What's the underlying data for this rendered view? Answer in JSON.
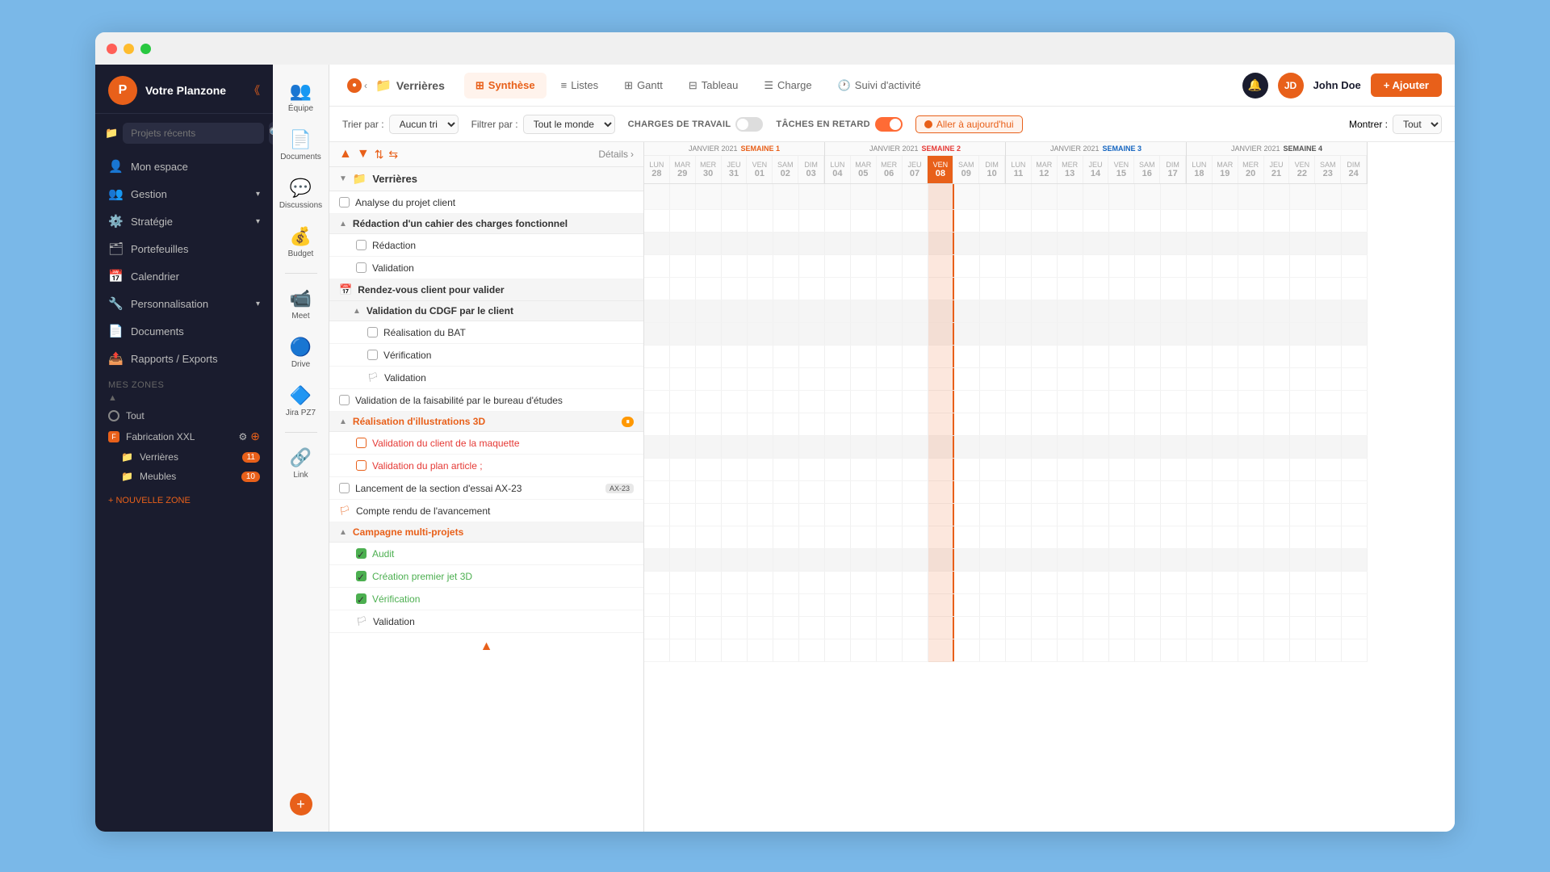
{
  "window": {
    "title": "Planzone"
  },
  "titlebar": {
    "dots": [
      "red",
      "yellow",
      "green"
    ]
  },
  "sidebar": {
    "logo_text": "P",
    "workspace": "Votre Planzone",
    "search_placeholder": "Projets récents",
    "nav_items": [
      {
        "id": "mon-espace",
        "label": "Mon espace",
        "icon": "👤"
      },
      {
        "id": "gestion",
        "label": "Gestion",
        "icon": "👥"
      },
      {
        "id": "strategie",
        "label": "Stratégie",
        "icon": "⚙️"
      },
      {
        "id": "portefeuilles",
        "label": "Portefeuilles",
        "icon": "🗂"
      },
      {
        "id": "calendrier",
        "label": "Calendrier",
        "icon": "📅"
      },
      {
        "id": "personnalisation",
        "label": "Personnalisation",
        "icon": "🔧"
      },
      {
        "id": "documents",
        "label": "Documents",
        "icon": "📄"
      },
      {
        "id": "rapports",
        "label": "Rapports / Exports",
        "icon": "📤"
      }
    ],
    "mes_zones": "Mes Zones",
    "zones": [
      {
        "id": "tout",
        "label": "Tout",
        "icon": "circle"
      },
      {
        "id": "fabrication-xxl",
        "label": "Fabrication XXL",
        "icon": "F",
        "color": "#e8601a",
        "has_settings": true
      },
      {
        "id": "verrieres",
        "label": "Verrières",
        "icon": "folder",
        "badge": "11"
      },
      {
        "id": "meubles",
        "label": "Meubles",
        "icon": "folder",
        "badge": "10"
      }
    ],
    "new_zone_label": "+ NOUVELLE ZONE"
  },
  "tools": [
    {
      "id": "equipe",
      "label": "Équipe",
      "icon": "👥"
    },
    {
      "id": "documents",
      "label": "Documents",
      "icon": "📄"
    },
    {
      "id": "discussions",
      "label": "Discussions",
      "icon": "💬"
    },
    {
      "id": "budget",
      "label": "Budget",
      "icon": "💰"
    },
    {
      "id": "meet",
      "label": "Meet",
      "icon": "📹"
    },
    {
      "id": "drive",
      "label": "Drive",
      "icon": "🔵"
    },
    {
      "id": "jira",
      "label": "Jira PZ7",
      "icon": "🔷"
    },
    {
      "id": "link",
      "label": "Link",
      "icon": "🔗"
    }
  ],
  "topnav": {
    "folder_name": "Verrières",
    "tabs": [
      {
        "id": "listes",
        "label": "Listes",
        "icon": "≡"
      },
      {
        "id": "gantt",
        "label": "Gantt",
        "icon": "⊞"
      },
      {
        "id": "tableau",
        "label": "Tableau",
        "icon": "⊟"
      },
      {
        "id": "charge",
        "label": "Charge",
        "icon": "☰"
      },
      {
        "id": "suivi",
        "label": "Suivi d'activité",
        "icon": "🕐"
      }
    ],
    "active_tab": "Synthèse",
    "active_tab_icon": "⊞",
    "notification_icon": "🔔",
    "user": {
      "name": "John Doe",
      "initials": "JD"
    },
    "add_button": "+ Ajouter"
  },
  "filters": {
    "trier_par_label": "Trier par :",
    "trier_value": "Aucun tri",
    "filtrer_par_label": "Filtrer par :",
    "filtrer_value": "Tout le monde",
    "charges_label": "CHARGES DE TRAVAIL",
    "taches_label": "TÂCHES EN RETARD",
    "today_btn": "Aller à aujourd'hui",
    "montrer_label": "Montrer :",
    "montrer_value": "Tout"
  },
  "gantt_header": {
    "weeks": [
      {
        "month": "JANVIER 2021",
        "week_num": "SEMAINE 1",
        "week_class": "s1",
        "days": [
          {
            "name": "LUN",
            "num": "28"
          },
          {
            "name": "MAR",
            "num": "29"
          },
          {
            "name": "MER",
            "num": "30"
          },
          {
            "name": "JEU",
            "num": "31"
          },
          {
            "name": "VEN",
            "num": "01"
          },
          {
            "name": "SAM",
            "num": "02"
          },
          {
            "name": "DIM",
            "num": "03"
          }
        ]
      },
      {
        "month": "JANVIER 2021",
        "week_num": "SEMAINE 2",
        "week_class": "s2",
        "days": [
          {
            "name": "LUN",
            "num": "04"
          },
          {
            "name": "MAR",
            "num": "05"
          },
          {
            "name": "MER",
            "num": "06"
          },
          {
            "name": "JEU",
            "num": "07"
          },
          {
            "name": "VEN",
            "num": "08",
            "today": true
          },
          {
            "name": "SAM",
            "num": "09"
          },
          {
            "name": "DIM",
            "num": "10"
          }
        ]
      },
      {
        "month": "JANVIER 2021",
        "week_num": "SEMAINE 3",
        "week_class": "s3",
        "days": [
          {
            "name": "LUN",
            "num": "11"
          },
          {
            "name": "MAR",
            "num": "12"
          },
          {
            "name": "MER",
            "num": "13"
          },
          {
            "name": "JEU",
            "num": "14"
          },
          {
            "name": "VEN",
            "num": "15"
          },
          {
            "name": "SAM",
            "num": "16"
          },
          {
            "name": "DIM",
            "num": "17"
          }
        ]
      },
      {
        "month": "JANVIER 2021",
        "week_num": "SEMAINE 4",
        "week_class": "s4",
        "days": [
          {
            "name": "LUN",
            "num": "18"
          },
          {
            "name": "MAR",
            "num": "19"
          },
          {
            "name": "MER",
            "num": "20"
          },
          {
            "name": "JEU",
            "num": "21"
          },
          {
            "name": "VEN",
            "num": "22"
          },
          {
            "name": "SAM",
            "num": "23"
          },
          {
            "name": "DIM",
            "num": "24"
          }
        ]
      }
    ]
  },
  "tasks": [
    {
      "type": "folder",
      "name": "Verrières",
      "indent": 0
    },
    {
      "type": "task",
      "name": "Analyse du projet client",
      "indent": 0,
      "checked": false
    },
    {
      "type": "group",
      "name": "Rédaction d'un cahier des charges fonctionnel",
      "indent": 0,
      "expanded": true
    },
    {
      "type": "task",
      "name": "Rédaction",
      "indent": 1,
      "checked": false
    },
    {
      "type": "task",
      "name": "Validation",
      "indent": 1,
      "checked": false
    },
    {
      "type": "group",
      "name": "Rendez-vous client pour valider",
      "indent": 0,
      "expanded": true,
      "icon": "calendar"
    },
    {
      "type": "group",
      "name": "Validation du CDGF par le client",
      "indent": 1,
      "expanded": true
    },
    {
      "type": "task",
      "name": "Réalisation du BAT",
      "indent": 2,
      "checked": false
    },
    {
      "type": "task",
      "name": "Vérification",
      "indent": 2,
      "checked": false
    },
    {
      "type": "task",
      "name": "Validation",
      "indent": 2,
      "flag": true
    },
    {
      "type": "task",
      "name": "Validation de la faisabilité par le bureau d'études",
      "indent": 0,
      "checked": false
    },
    {
      "type": "group",
      "name": "Réalisation d'illustrations 3D",
      "indent": 0,
      "expanded": true,
      "color": "orange",
      "pause": true
    },
    {
      "type": "task",
      "name": "Validation du client de la maquette",
      "indent": 1,
      "checked": false,
      "color": "red"
    },
    {
      "type": "task",
      "name": "Validation du plan article ;",
      "indent": 1,
      "checked": false,
      "color": "red"
    },
    {
      "type": "task",
      "name": "Lancement de la section d'essai AX-23",
      "indent": 0,
      "checked": false,
      "tag": "AX-23"
    },
    {
      "type": "task",
      "name": "Compte rendu de l'avancement",
      "indent": 0,
      "flag": true
    },
    {
      "type": "group",
      "name": "Campagne multi-projets",
      "indent": 0,
      "expanded": true,
      "color": "orange"
    },
    {
      "type": "task",
      "name": "Audit",
      "indent": 1,
      "checked": true,
      "color": "green"
    },
    {
      "type": "task",
      "name": "Création premier jet 3D",
      "indent": 1,
      "checked": true,
      "color": "green"
    },
    {
      "type": "task",
      "name": "Vérification",
      "indent": 1,
      "checked": true,
      "color": "green"
    },
    {
      "type": "task",
      "name": "Validation",
      "indent": 1,
      "flag": true
    }
  ]
}
